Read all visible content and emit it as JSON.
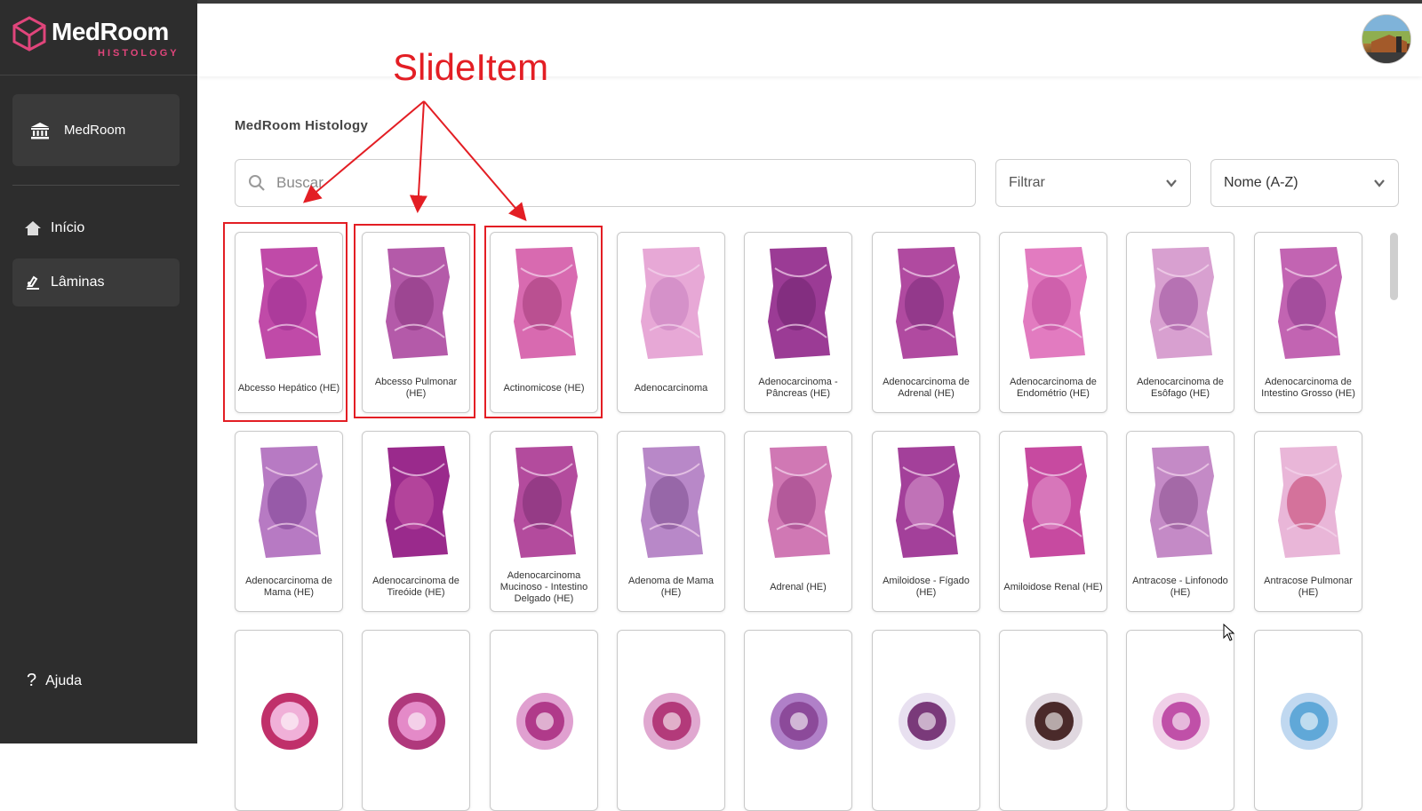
{
  "app": {
    "logo_text": "MedRoom",
    "logo_sub": "HISTOLOGY",
    "brand_color": "#e0457b"
  },
  "sidebar": {
    "org_label": "MedRoom",
    "org_icon": "institution-icon",
    "items": [
      {
        "label": "Início",
        "icon": "home-icon",
        "active": false
      },
      {
        "label": "Lâminas",
        "icon": "slides-icon",
        "active": true
      }
    ],
    "help_label": "Ajuda"
  },
  "header": {
    "avatar": "user-avatar"
  },
  "main": {
    "title": "MedRoom Histology",
    "search": {
      "placeholder": "Buscar",
      "value": ""
    },
    "filter": {
      "label": "Filtrar"
    },
    "sort": {
      "label": "Nome (A-Z)"
    },
    "slides": [
      {
        "name": "Abcesso Hepático (HE)"
      },
      {
        "name": "Abcesso Pulmonar (HE)"
      },
      {
        "name": "Actinomicose (HE)"
      },
      {
        "name": "Adenocarcinoma"
      },
      {
        "name": "Adenocarcinoma - Pâncreas (HE)"
      },
      {
        "name": "Adenocarcinoma de Adrenal (HE)"
      },
      {
        "name": "Adenocarcinoma de Endométrio (HE)"
      },
      {
        "name": "Adenocarcinoma de Esôfago (HE)"
      },
      {
        "name": "Adenocarcinoma de Intestino Grosso (HE)"
      },
      {
        "name": "Adenocarcinoma de Mama (HE)"
      },
      {
        "name": "Adenocarcinoma de Tireóide (HE)"
      },
      {
        "name": "Adenocarcinoma Mucinoso - Intestino Delgado (HE)"
      },
      {
        "name": "Adenoma de Mama (HE)"
      },
      {
        "name": "Adrenal (HE)"
      },
      {
        "name": "Amiloidose - Fígado (HE)"
      },
      {
        "name": "Amiloidose Renal (HE)"
      },
      {
        "name": "Antracose - Linfonodo (HE)"
      },
      {
        "name": "Antracose Pulmonar (HE)"
      },
      {
        "name": ""
      },
      {
        "name": ""
      },
      {
        "name": ""
      },
      {
        "name": ""
      },
      {
        "name": ""
      },
      {
        "name": ""
      },
      {
        "name": ""
      },
      {
        "name": ""
      },
      {
        "name": ""
      }
    ]
  },
  "annotation": {
    "label": "SlideItem",
    "color": "#e31e24"
  }
}
